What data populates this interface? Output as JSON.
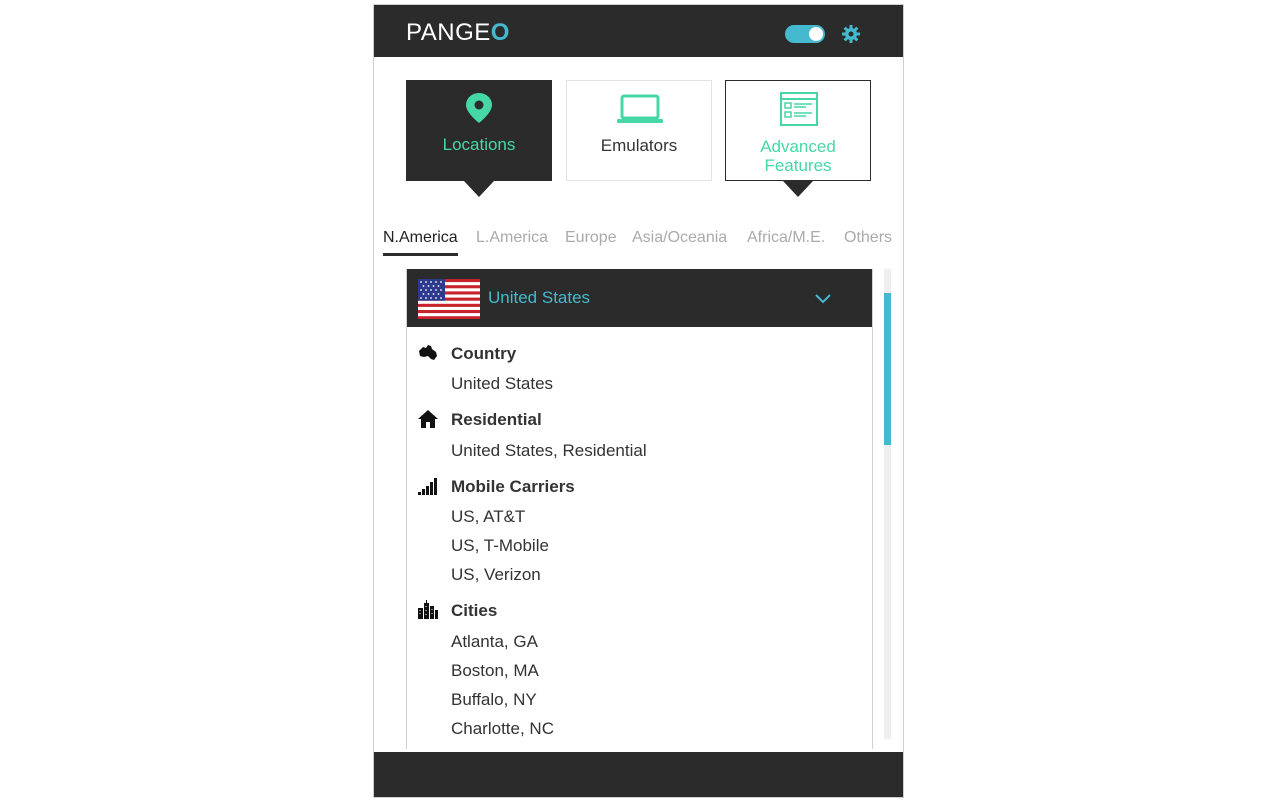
{
  "app": {
    "logo_text": "PANGE",
    "logo_o": "O",
    "toggle_on": true,
    "accent": "#45b9cf",
    "green": "#45d8a6",
    "dark": "#2b2b2b"
  },
  "tabs": [
    {
      "label": "Locations",
      "icon": "map-pin-icon",
      "active": true
    },
    {
      "label": "Emulators",
      "icon": "laptop-icon",
      "active": false
    },
    {
      "label": "Advanced Features",
      "line1": "Advanced",
      "line2": "Features",
      "icon": "browser-window-icon",
      "active": false
    }
  ],
  "regions": [
    "N.America",
    "L.America",
    "Europe",
    "Asia/Oceania",
    "Africa/M.E.",
    "Others"
  ],
  "active_region": "N.America",
  "country": {
    "name": "United States",
    "flag_icon": "us-flag-icon",
    "expanded": true
  },
  "sections": [
    {
      "title": "Country",
      "icon": "continent-icon",
      "items": [
        "United States"
      ]
    },
    {
      "title": "Residential",
      "icon": "home-icon",
      "items": [
        "United States, Residential"
      ]
    },
    {
      "title": "Mobile Carriers",
      "icon": "signal-bars-icon",
      "items": [
        "US, AT&T",
        "US, T-Mobile",
        "US, Verizon"
      ]
    },
    {
      "title": "Cities",
      "icon": "city-icon",
      "items": [
        "Atlanta, GA",
        "Boston, MA",
        "Buffalo, NY",
        "Charlotte, NC"
      ]
    }
  ]
}
